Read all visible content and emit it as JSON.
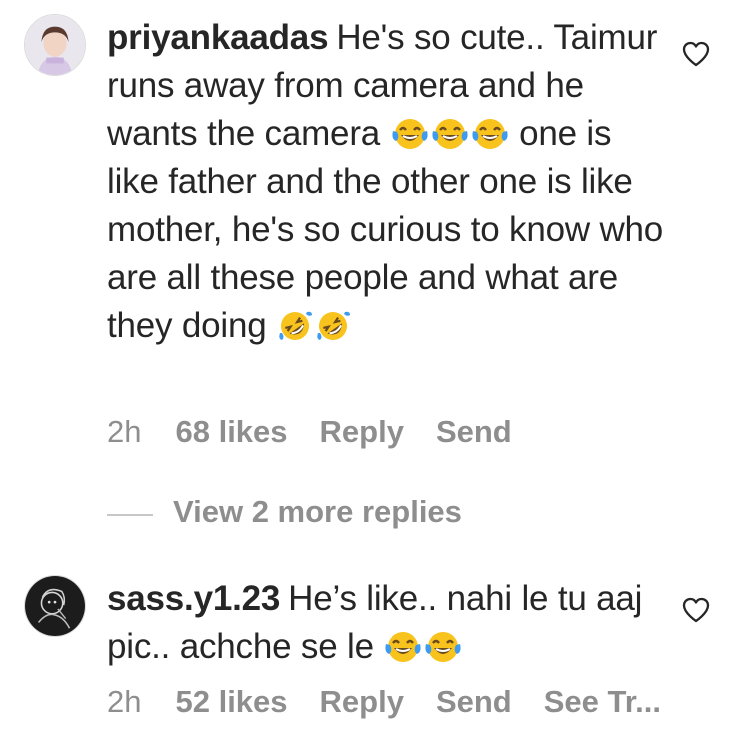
{
  "comments": [
    {
      "username": "priyankaadas",
      "text_part1": "He's so cute.. Taimur runs away from camera and he wants the camera",
      "emoji_group1": "face-with-tears-of-joy x3",
      "text_part2": "one is like father and the other one is like mother, he's so curious to know who are all these people and what are they doing",
      "emoji_group2": "rolling-on-the-floor-laughing x2",
      "time": "2h",
      "likes": "68 likes",
      "reply": "Reply",
      "send": "Send"
    },
    {
      "username": "sass.y1.23",
      "text_part1": "He’s like.. nahi le tu aaj pic.. achche se le",
      "emoji_group1": "face-with-tears-of-joy x2",
      "time": "2h",
      "likes": "52 likes",
      "reply": "Reply",
      "send": "Send",
      "see_translation": "See Tr..."
    }
  ],
  "view_more_replies": "View 2 more replies",
  "colors": {
    "text": "#262626",
    "secondary": "#8e8e8e",
    "emoji_face": "#f8c31d",
    "emoji_tear": "#3d9cf0"
  }
}
